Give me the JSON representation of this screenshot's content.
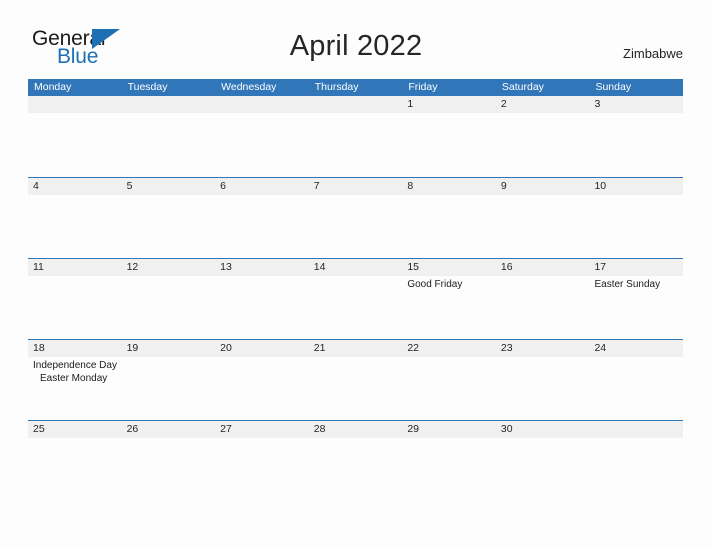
{
  "logo": {
    "primary_text": "General",
    "secondary_text": "Blue",
    "primary_color": "#1b1b1b",
    "secondary_color": "#1f6fb5",
    "icon": "triangle-flag-icon"
  },
  "header": {
    "title": "April 2022",
    "country": "Zimbabwe"
  },
  "colors": {
    "header_blue": "#3176b9",
    "daynum_band": "#f0f0f0",
    "page_background": "#fdfdfd",
    "text": "#252525"
  },
  "calendar": {
    "month": "April",
    "year": "2022",
    "weekday_headers": [
      "Monday",
      "Tuesday",
      "Wednesday",
      "Thursday",
      "Friday",
      "Saturday",
      "Sunday"
    ],
    "weeks": [
      {
        "days": [
          {
            "number": "",
            "events": []
          },
          {
            "number": "",
            "events": []
          },
          {
            "number": "",
            "events": []
          },
          {
            "number": "",
            "events": []
          },
          {
            "number": "1",
            "events": []
          },
          {
            "number": "2",
            "events": []
          },
          {
            "number": "3",
            "events": []
          }
        ]
      },
      {
        "days": [
          {
            "number": "4",
            "events": []
          },
          {
            "number": "5",
            "events": []
          },
          {
            "number": "6",
            "events": []
          },
          {
            "number": "7",
            "events": []
          },
          {
            "number": "8",
            "events": []
          },
          {
            "number": "9",
            "events": []
          },
          {
            "number": "10",
            "events": []
          }
        ]
      },
      {
        "days": [
          {
            "number": "11",
            "events": []
          },
          {
            "number": "12",
            "events": []
          },
          {
            "number": "13",
            "events": []
          },
          {
            "number": "14",
            "events": []
          },
          {
            "number": "15",
            "events": [
              {
                "label": "Good Friday",
                "indent": false
              }
            ]
          },
          {
            "number": "16",
            "events": []
          },
          {
            "number": "17",
            "events": [
              {
                "label": "Easter Sunday",
                "indent": false
              }
            ]
          }
        ]
      },
      {
        "days": [
          {
            "number": "18",
            "events": [
              {
                "label": "Independence Day",
                "indent": false
              },
              {
                "label": "Easter Monday",
                "indent": true
              }
            ]
          },
          {
            "number": "19",
            "events": []
          },
          {
            "number": "20",
            "events": []
          },
          {
            "number": "21",
            "events": []
          },
          {
            "number": "22",
            "events": []
          },
          {
            "number": "23",
            "events": []
          },
          {
            "number": "24",
            "events": []
          }
        ]
      },
      {
        "days": [
          {
            "number": "25",
            "events": []
          },
          {
            "number": "26",
            "events": []
          },
          {
            "number": "27",
            "events": []
          },
          {
            "number": "28",
            "events": []
          },
          {
            "number": "29",
            "events": []
          },
          {
            "number": "30",
            "events": []
          },
          {
            "number": "",
            "events": []
          }
        ]
      }
    ]
  }
}
